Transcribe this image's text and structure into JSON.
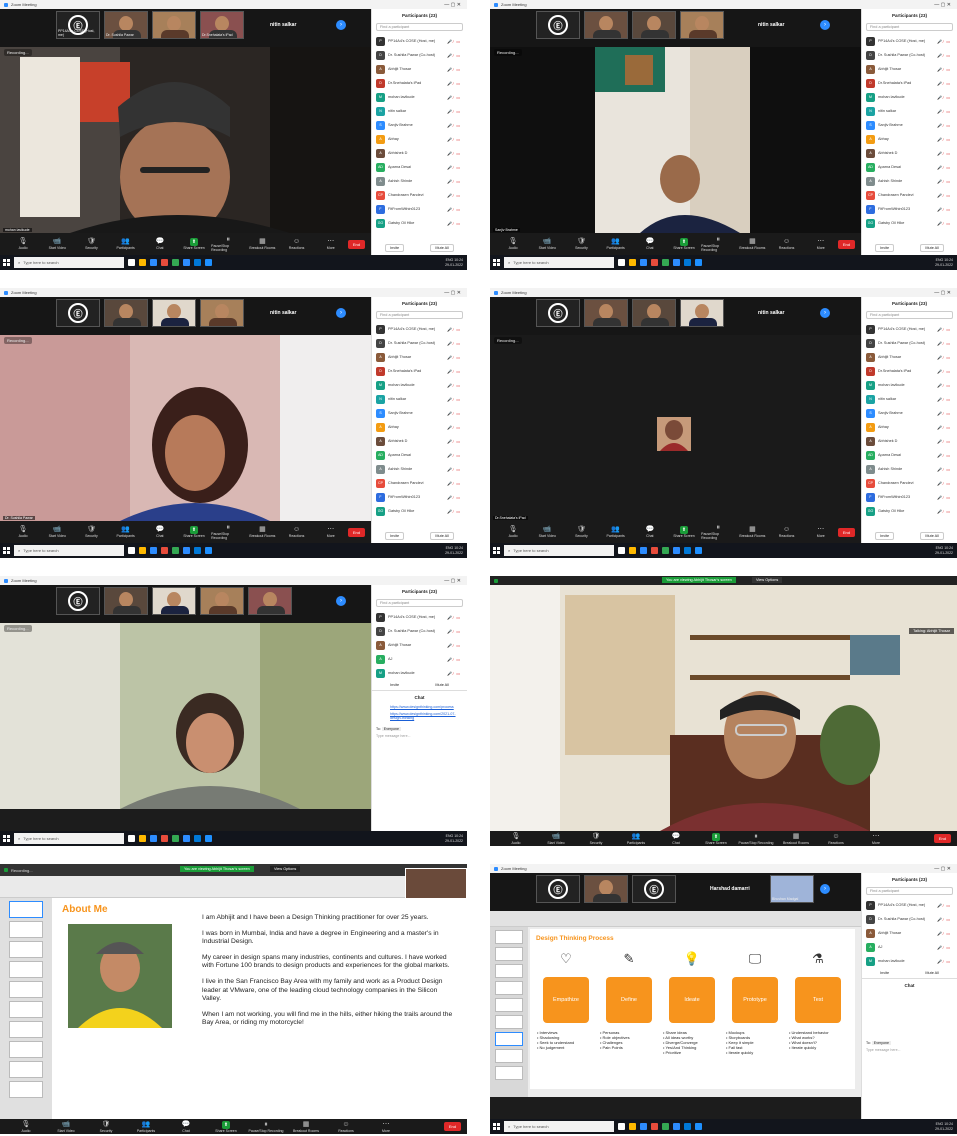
{
  "app_title": "Zoom Meeting",
  "toolbar": {
    "buttons": [
      {
        "label": "Audio",
        "icon": "mic"
      },
      {
        "label": "Start Video",
        "icon": "video"
      },
      {
        "label": "Security",
        "icon": "shield"
      },
      {
        "label": "Participants",
        "icon": "people",
        "count": "23"
      },
      {
        "label": "Chat",
        "icon": "chat"
      },
      {
        "label": "Share Screen",
        "icon": "share"
      },
      {
        "label": "Pause/Stop Recording",
        "icon": "record"
      },
      {
        "label": "Breakout Rooms",
        "icon": "rooms"
      },
      {
        "label": "Reactions",
        "icon": "smile"
      },
      {
        "label": "More",
        "icon": "dots"
      }
    ],
    "end_label": "End"
  },
  "taskbar": {
    "search_placeholder": "Type here to search",
    "clock": "10:24",
    "date": "29-01-2022",
    "lang": "ENG"
  },
  "recording_label": "Recording...",
  "thumbs": {
    "pp": "PP14A4's COSE (Host, me)",
    "sushila": "Dr. Sushila Pawar",
    "snehalata": "Dr.Snehalata's iPad",
    "nitin": "nitin salkar",
    "mohan": "mohan lavikude",
    "sanjiv": "Sanjiv Brahme",
    "harshad": "Harshad damarri",
    "bhushan": "Bhushan Madgal"
  },
  "participants_panel": {
    "title": "Participants (23)",
    "search_placeholder": "Find a participant",
    "invite_label": "Invite",
    "mute_all_label": "Mute All",
    "list": [
      {
        "name": "PP14A4's COSE (Host, me)",
        "initial": "P",
        "color": "#333333"
      },
      {
        "name": "Dr. Sushila Pawar (Co-host)",
        "initial": "D",
        "color": "#444444"
      },
      {
        "name": "Abhijit Thosar",
        "initial": "A",
        "color": "#8a5a3a"
      },
      {
        "name": "Dr.Snehalata's iPad",
        "initial": "D",
        "color": "#c0392b"
      },
      {
        "name": "mohan lavikude",
        "initial": "M",
        "color": "#16a085"
      },
      {
        "name": "nitin salkar",
        "initial": "N",
        "color": "#1aa3a3"
      },
      {
        "name": "Sanjiv Brahme",
        "initial": "S",
        "color": "#2d8cff"
      },
      {
        "name": "Abhay",
        "initial": "A",
        "color": "#f39c12"
      },
      {
        "name": "Abhishek D",
        "initial": "A",
        "color": "#6b4c3b"
      },
      {
        "name": "Aparna Desai",
        "initial": "AD",
        "color": "#27ae60"
      },
      {
        "name": "Ashish Shinde",
        "initial": "A",
        "color": "#7f8c8d"
      },
      {
        "name": "Chandrasen Pandevi",
        "initial": "CP",
        "color": "#e74c3c"
      },
      {
        "name": "FitFromWithin0123",
        "initial": "F",
        "color": "#2d6cdf"
      },
      {
        "name": "Gatsby Oil Hike",
        "initial": "GO",
        "color": "#16a085"
      }
    ]
  },
  "participants_short": [
    {
      "name": "PP14A4's COSE (Host, me)",
      "initial": "P",
      "color": "#333333"
    },
    {
      "name": "Dr. Sushila Pawar (Co-host)",
      "initial": "D",
      "color": "#444444"
    },
    {
      "name": "Abhijit Thosar",
      "initial": "A",
      "color": "#8a5a3a"
    },
    {
      "name": "AJ",
      "initial": "A",
      "color": "#27ae60"
    },
    {
      "name": "mohan lavikude",
      "initial": "M",
      "color": "#16a085"
    }
  ],
  "chat": {
    "title": "Chat",
    "links": [
      "https://www.designthinking.com/process",
      "https://www.designthinking.com/2021-07-design-thinking"
    ],
    "to_label": "To:",
    "to_value": "Everyone",
    "placeholder": "Type message here..."
  },
  "talking_label": "Talking: Abhijit Thosar",
  "viewing_banner": "You are viewing Abhijit Thosar's screen",
  "view_options": "View Options",
  "slide_about": {
    "title": "About Me",
    "paragraphs": [
      "I am Abhijit and I have been a Design Thinking practitioner for over 25 years.",
      "I was born in Mumbai, India and have a degree in Engineering and a master's in Industrial Design.",
      "My career in design spans many industries, continents and cultures. I have worked with Fortune 100 brands to design products and experiences for the global markets.",
      "I live in the San Francisco Bay Area with my family and work as a Product Design leader at VMware, one of the leading cloud technology companies in the Silicon Valley.",
      "When I am not working, you will find me in the hills, either hiking the trails around the Bay Area, or riding my motorcycle!"
    ]
  },
  "slide_process": {
    "title": "Design Thinking Process",
    "steps": [
      {
        "label": "Empathize",
        "icon": "heart-icon",
        "bullets": [
          "Interviews",
          "Shadowing",
          "Seek to understand",
          "No judgement"
        ]
      },
      {
        "label": "Define",
        "icon": "pencil-icon",
        "bullets": [
          "Personas",
          "Role objectives",
          "Challenges",
          "Pain Points"
        ]
      },
      {
        "label": "Ideate",
        "icon": "lightbulb-icon",
        "bullets": [
          "Share ideas",
          "All ideas worthy",
          "Diverge/Converge",
          "Yes/And Thinking",
          "Prioritize"
        ]
      },
      {
        "label": "Prototype",
        "icon": "monitor-icon",
        "bullets": [
          "Mockups",
          "Storyboards",
          "Keep it simple",
          "Fail fast",
          "Iterate quickly"
        ]
      },
      {
        "label": "Test",
        "icon": "testtube-icon",
        "bullets": [
          "Understand behavior",
          "What works?",
          "What doesn't?",
          "Iterate quickly"
        ]
      }
    ]
  },
  "colors": {
    "accent": "#2d8cff",
    "end": "#e02828",
    "slide_orange": "#f7941d"
  }
}
